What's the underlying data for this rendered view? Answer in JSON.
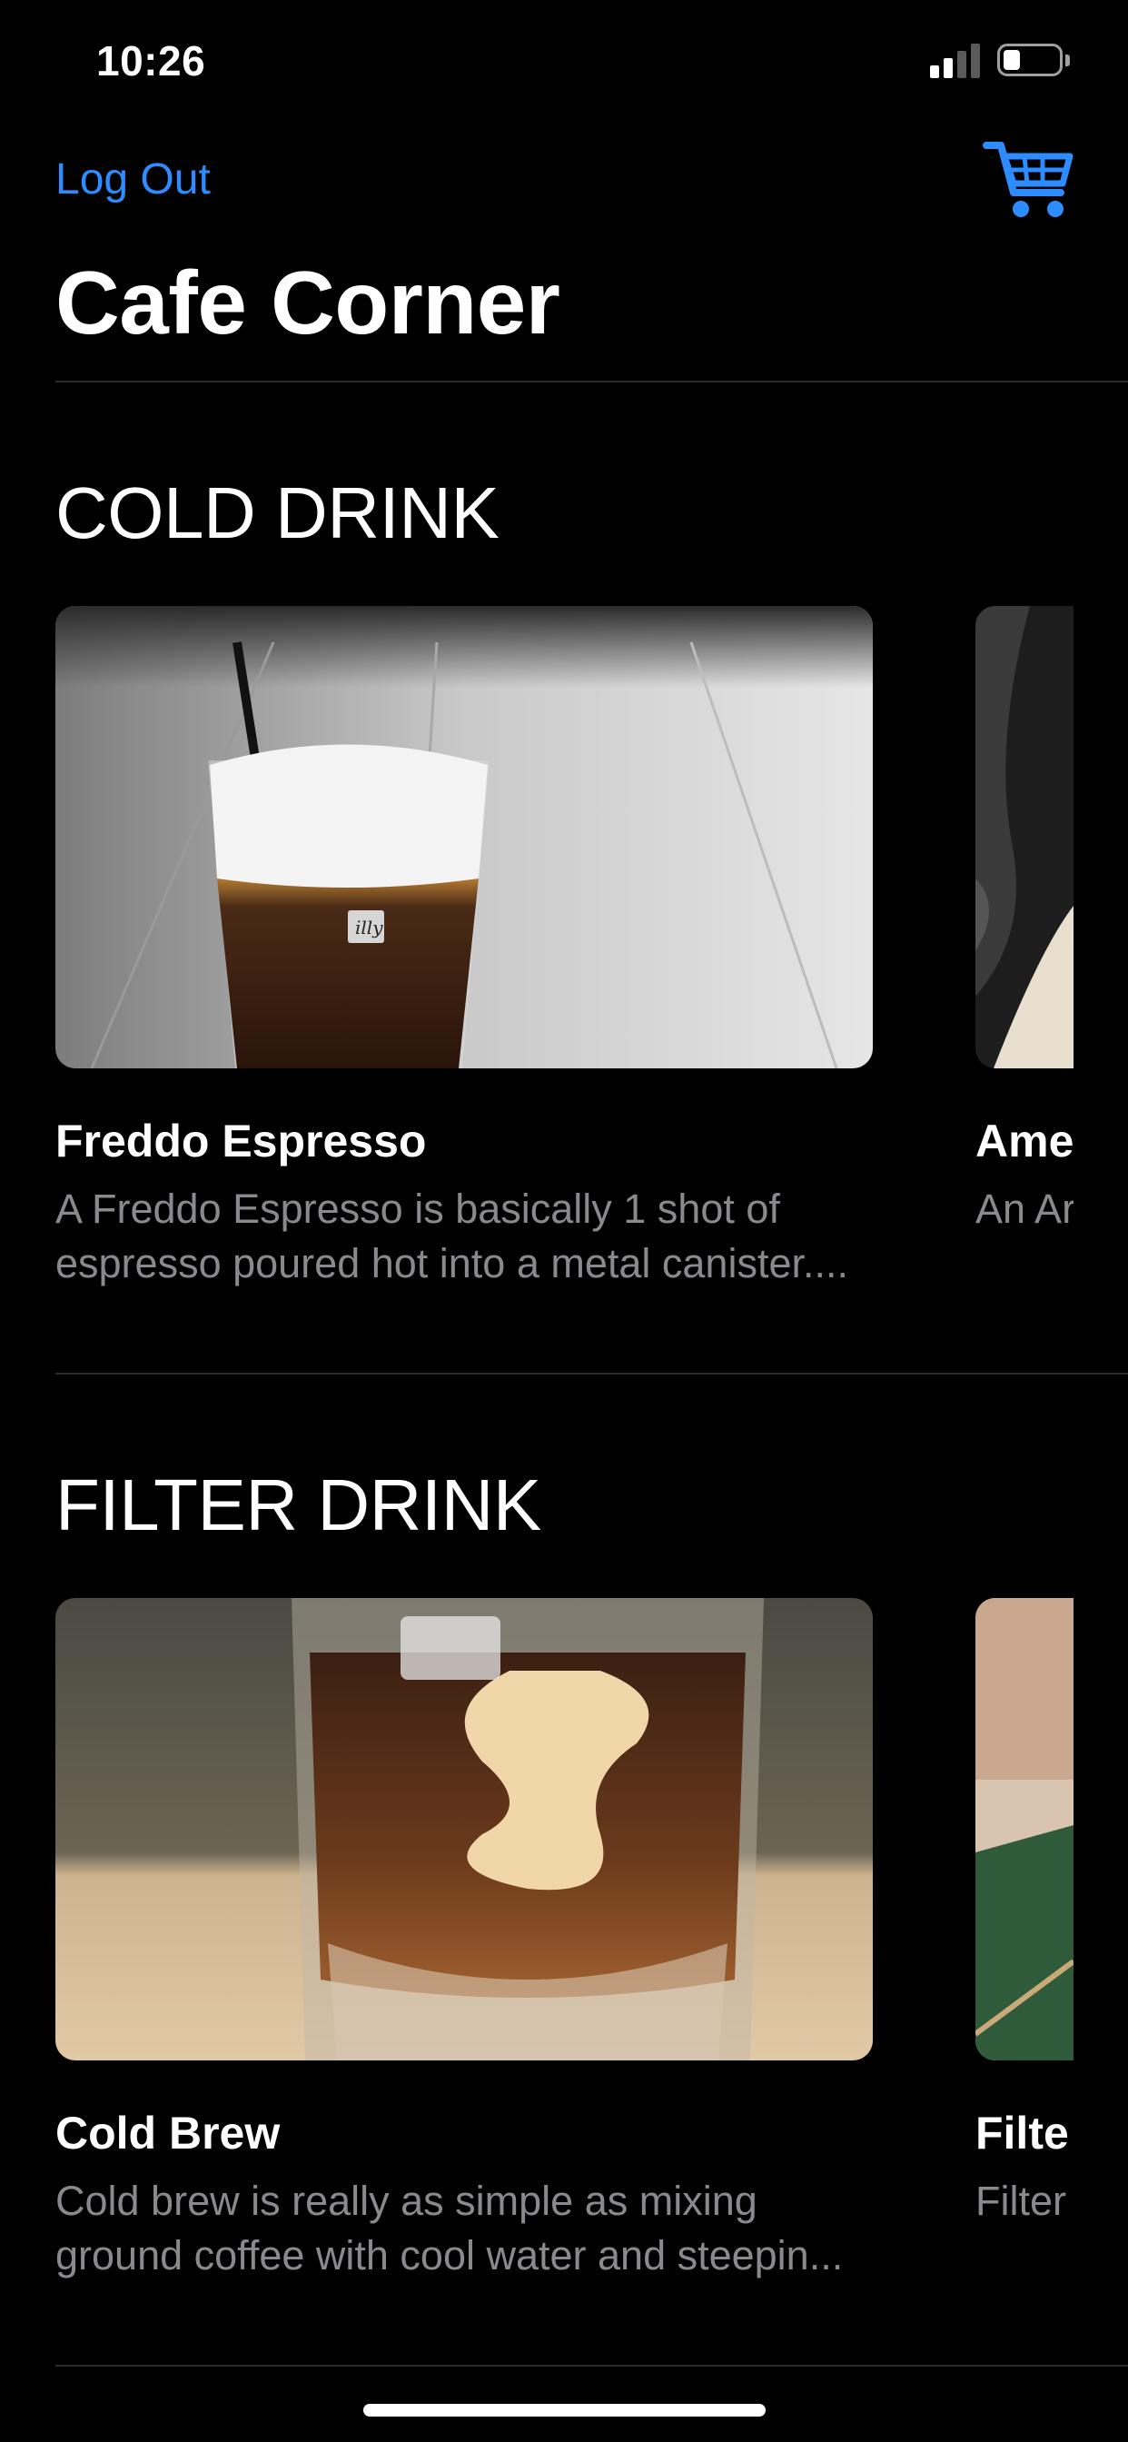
{
  "status_bar": {
    "time": "10:26"
  },
  "nav": {
    "logout_label": "Log Out",
    "cart_icon": "cart-icon",
    "title": "Cafe Corner"
  },
  "colors": {
    "accent": "#2d8cff",
    "background": "#000000",
    "secondary_text": "#8a8a8e"
  },
  "sections": [
    {
      "title": "COLD DRINK",
      "items": [
        {
          "name": "Freddo Espresso",
          "description": "A Freddo Espresso is basically 1 shot of espresso poured hot into a metal canister...."
        },
        {
          "name": "Ame",
          "description": "An Ar coffe"
        }
      ]
    },
    {
      "title": "FILTER DRINK",
      "items": [
        {
          "name": "Cold Brew",
          "description": "Cold brew is really as simple as mixing ground coffee with cool water and steepin..."
        },
        {
          "name": "Filte",
          "description": "Filter water"
        }
      ]
    }
  ]
}
